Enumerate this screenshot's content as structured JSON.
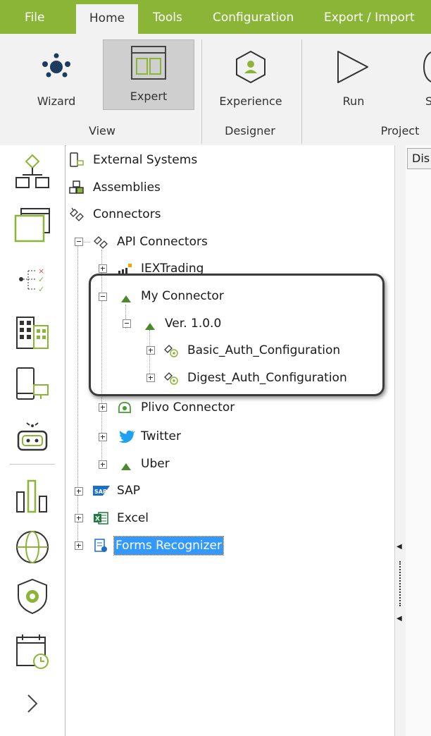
{
  "menu": {
    "tabs": [
      "File",
      "Home",
      "Tools",
      "Configuration",
      "Export / Import"
    ],
    "active": "Home"
  },
  "ribbon": {
    "buttons": {
      "wizard": "Wizard",
      "expert": "Expert",
      "experience": "Experience",
      "run": "Run",
      "partial": "S"
    },
    "groups": {
      "view": "View",
      "designer": "Designer",
      "project": "Project"
    }
  },
  "sidebar": {
    "icons": [
      "flow-diagram-icon",
      "window-icon",
      "checklist-icon",
      "buildings-icon",
      "device-icon",
      "robot-icon",
      "bar-chart-icon",
      "globe-icon",
      "shield-gear-icon",
      "calendar-clock-icon",
      "chevron-right-icon"
    ]
  },
  "tree": {
    "external_systems": "External Systems",
    "assemblies": "Assemblies",
    "connectors": "Connectors",
    "api_connectors": "API Connectors",
    "iextrading": "IEXTrading",
    "my_connector": "My Connector",
    "version": "Ver. 1.0.0",
    "basic_auth": "Basic_Auth_Configuration",
    "digest_auth": "Digest_Auth_Configuration",
    "plivo": "Plivo Connector",
    "twitter": "Twitter",
    "uber": "Uber",
    "sap": "SAP",
    "excel": "Excel",
    "forms_recognizer": "Forms Recognizer"
  },
  "right_panel": {
    "tab": "Dis"
  },
  "colors": {
    "accent": "#8ab536",
    "selection": "#3399ff",
    "twitter": "#1da1f2",
    "sap": "#1a6fc9",
    "excel": "#1f7a3f"
  }
}
